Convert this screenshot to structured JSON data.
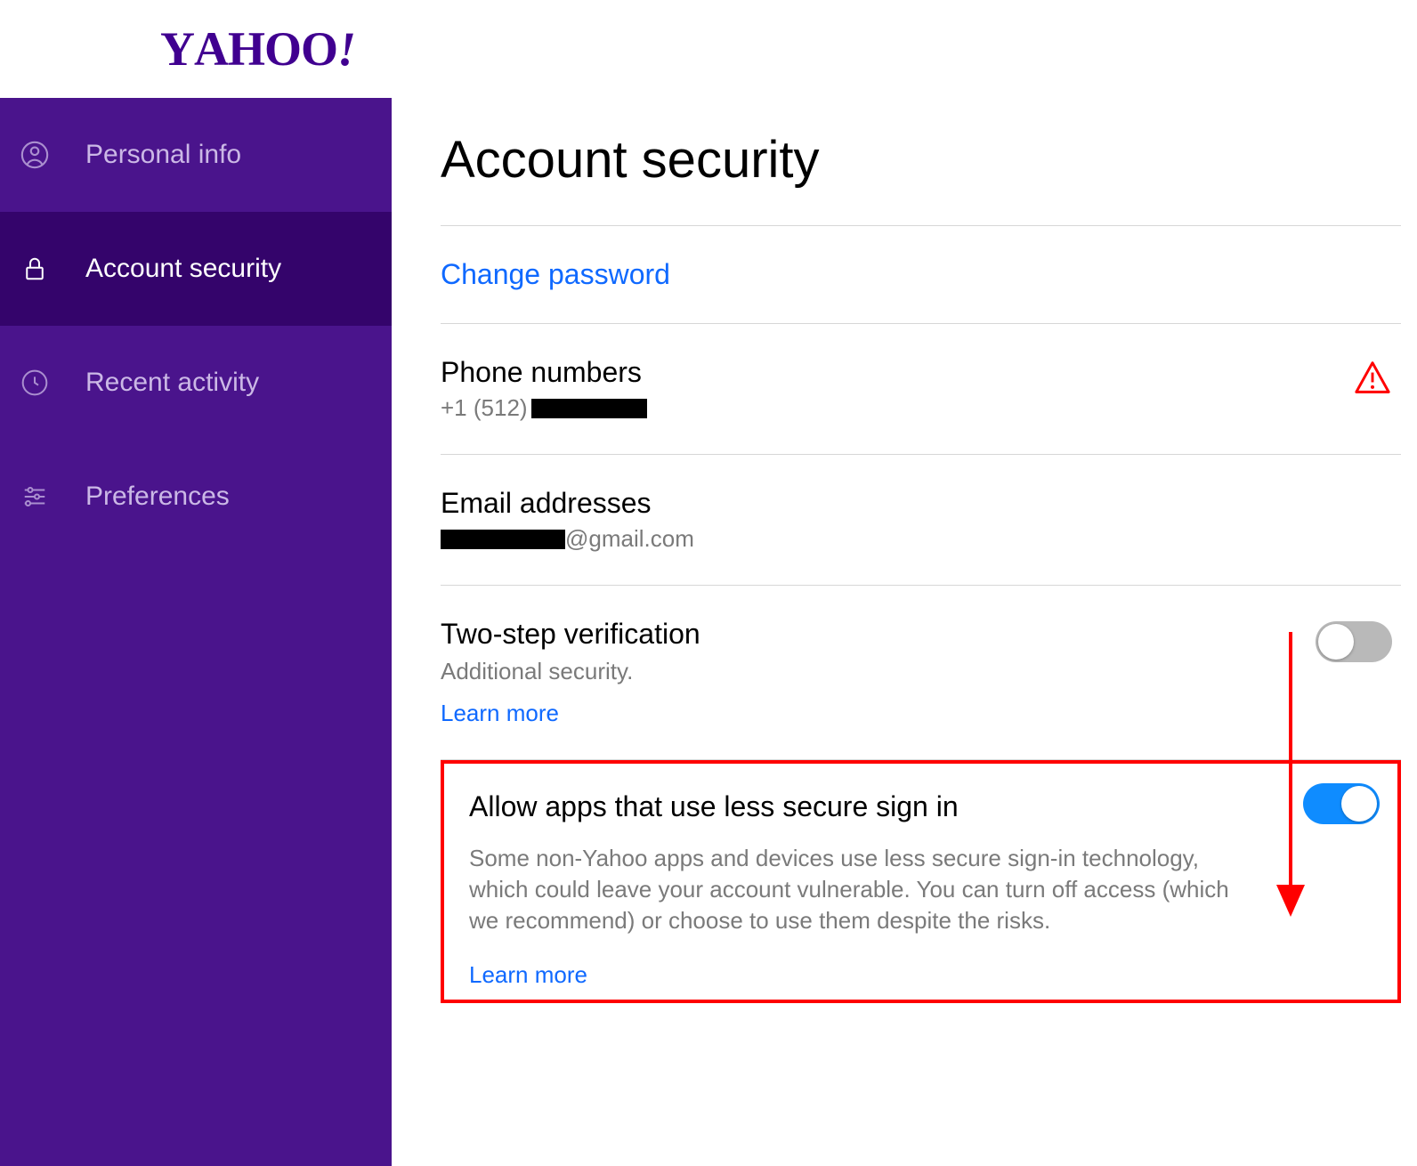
{
  "logo": "YAHOO!",
  "sidebar": {
    "items": [
      {
        "label": "Personal info"
      },
      {
        "label": "Account security"
      },
      {
        "label": "Recent activity"
      },
      {
        "label": "Preferences"
      }
    ]
  },
  "main": {
    "title": "Account security",
    "change_password": "Change password",
    "phone": {
      "title": "Phone numbers",
      "prefix": "+1 (512)"
    },
    "email": {
      "title": "Email addresses",
      "domain": "@gmail.com"
    },
    "twostep": {
      "title": "Two-step verification",
      "desc": "Additional security.",
      "learn": "Learn more"
    },
    "less_secure": {
      "title": "Allow apps that use less secure sign in",
      "desc": "Some non-Yahoo apps and devices use less secure sign-in technology, which could leave your account vulnerable. You can turn off access (which we recommend) or choose to use them despite the risks.",
      "learn": "Learn more"
    }
  }
}
